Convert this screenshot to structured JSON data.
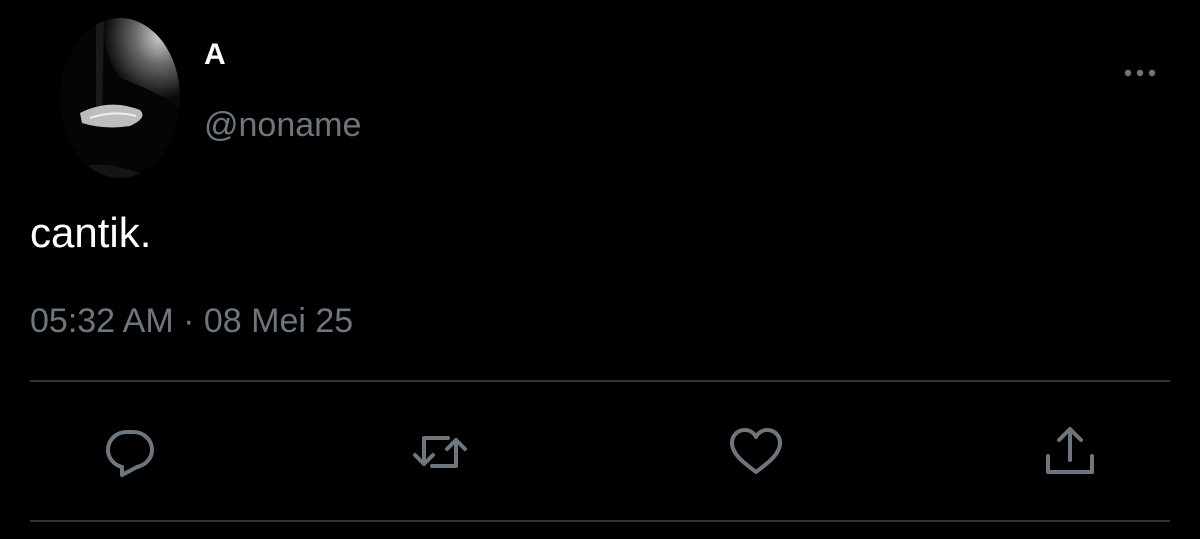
{
  "tweet": {
    "display_name": "A",
    "handle": "@noname",
    "text": "cantik.",
    "timestamp": "05:32 AM · 08 Mei 25"
  },
  "icons": {
    "avatar": "profile-photo-monochrome",
    "more": "more-horizontal-icon",
    "reply": "reply-icon",
    "retweet": "retweet-icon",
    "like": "heart-icon",
    "share": "share-icon"
  },
  "colors": {
    "background": "#000000",
    "primary_text": "#ffffff",
    "secondary_text": "#6e767d",
    "divider": "#2f3336"
  }
}
